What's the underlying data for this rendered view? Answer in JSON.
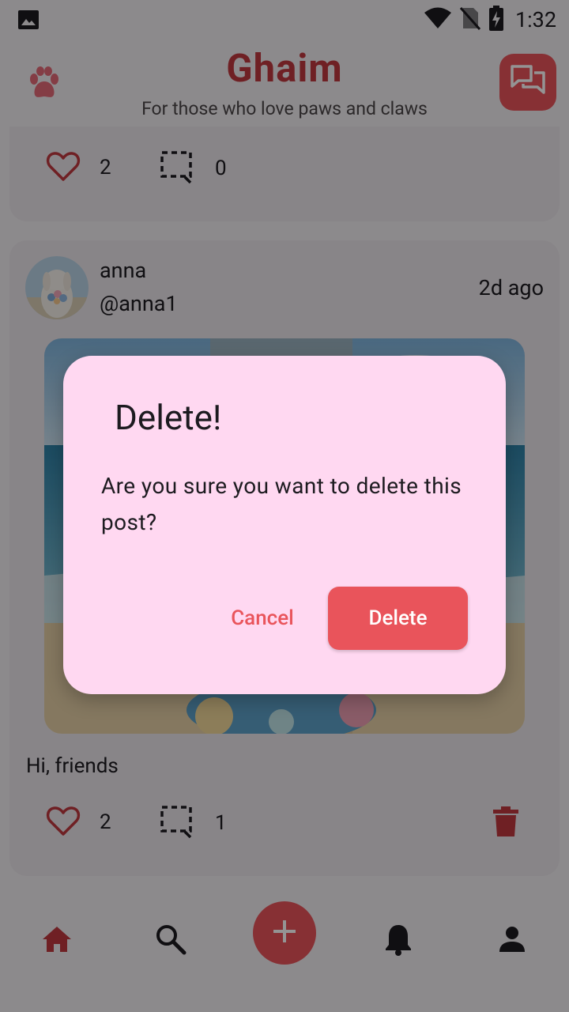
{
  "status_bar": {
    "time": "1:32"
  },
  "app": {
    "title": "Ghaim",
    "tagline": "For those who love paws and claws"
  },
  "posts": [
    {
      "likes": "2",
      "comments": "0"
    },
    {
      "name": "anna",
      "handle": "@anna1",
      "time_ago": "2d ago",
      "caption": "Hi, friends",
      "likes": "2",
      "comments": "1"
    }
  ],
  "dialog": {
    "title": "Delete!",
    "message": "Are you sure you want to delete this post?",
    "cancel_label": "Cancel",
    "delete_label": "Delete"
  },
  "nav": {
    "items": [
      "home-icon",
      "search-icon",
      "add-icon",
      "bell-icon",
      "person-icon"
    ]
  },
  "colors": {
    "accent": "#e9545b",
    "brand": "#c0383e",
    "dialog_bg": "#ffd8f1",
    "card_bg": "#ebe5ea"
  }
}
